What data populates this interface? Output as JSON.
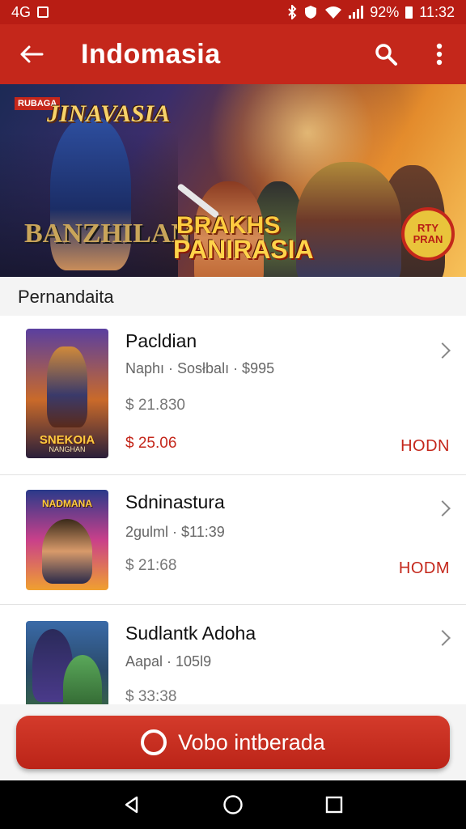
{
  "status_bar": {
    "left_text": "4G",
    "battery_text": "92%",
    "time": "11:32"
  },
  "app_bar": {
    "title": "Indomasia",
    "icons": [
      "back-arrow-icon",
      "search-icon",
      "more-vert-icon"
    ]
  },
  "banner": {
    "tag": "RUBAGA",
    "logo_top": "JINAVASIA",
    "logo_left": "BANZHILAN",
    "logo_left_sub": "",
    "logo_mid_line1": "BRAKHS",
    "logo_mid_line2": "PANIRASIA",
    "badge_line1": "RTY",
    "badge_line2": "PRAN"
  },
  "section": {
    "title": "Pernandaita"
  },
  "items": [
    {
      "thumb_caption": "SNEKOIA",
      "thumb_subcaption": "NANGHAN",
      "thumb_caption_top": "",
      "title": "Pacldian",
      "meta": "Naphı · Sosłbalı · $995",
      "price": "$ 21.830",
      "sale_price": "$ 25.06",
      "status": "HODN"
    },
    {
      "thumb_caption": "",
      "thumb_subcaption": "",
      "thumb_caption_top": "NADMANA",
      "title": "Sdninastura",
      "meta": "2gulml · $11:39",
      "price": "$ 21:68",
      "sale_price": "",
      "status": "HODM"
    },
    {
      "thumb_caption": "",
      "thumb_subcaption": "",
      "thumb_caption_top": "",
      "title": "Sudlantk Adoha",
      "meta": "Aapal · 105l9",
      "price": "$ 33:38",
      "sale_price": "",
      "status": ""
    }
  ],
  "primary_action": {
    "label": "Vobo intberada"
  },
  "colors": {
    "brand_red": "#c4271b",
    "status_bar_red": "#b81d14",
    "accent_gold": "#e9c43b"
  }
}
